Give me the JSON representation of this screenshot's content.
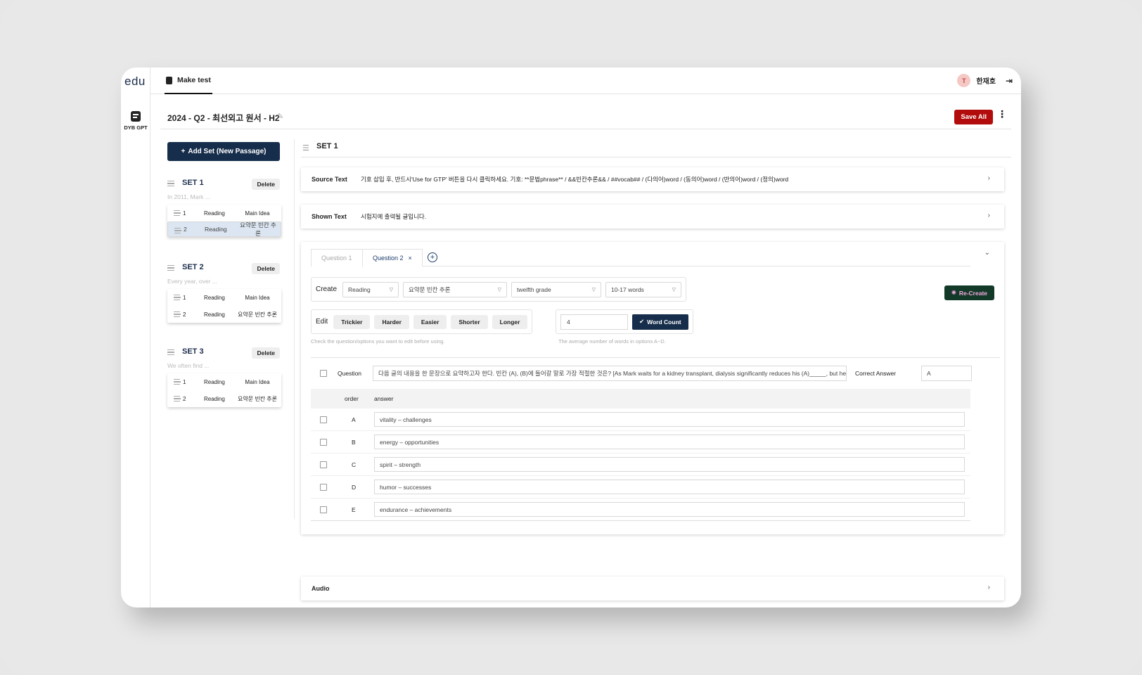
{
  "app": {
    "logo": "edu",
    "rail_item": "DYB GPT"
  },
  "topbar": {
    "tab": "Make test",
    "user_initial": "T",
    "user_name": "한재호"
  },
  "header": {
    "title": "2024 - Q2 - 최선외고 원서 - H2",
    "save_all": "Save All"
  },
  "sidebar": {
    "add_set": "Add Set (New Passage)",
    "delete_label": "Delete",
    "sets": [
      {
        "name": "SET 1",
        "preview": "In 2011, Mark ...",
        "questions": [
          {
            "n": "1",
            "type": "Reading",
            "kind": "Main Idea"
          },
          {
            "n": "2",
            "type": "Reading",
            "kind": "요약문 빈칸 추론"
          }
        ]
      },
      {
        "name": "SET 2",
        "preview": "Every year, over ...",
        "questions": [
          {
            "n": "1",
            "type": "Reading",
            "kind": "Main Idea"
          },
          {
            "n": "2",
            "type": "Reading",
            "kind": "요약문 빈칸 추론"
          }
        ]
      },
      {
        "name": "SET 3",
        "preview": "We often find ...",
        "questions": [
          {
            "n": "1",
            "type": "Reading",
            "kind": "Main Idea"
          },
          {
            "n": "2",
            "type": "Reading",
            "kind": "요약문 빈칸 추론"
          }
        ]
      }
    ]
  },
  "main": {
    "set_title": "SET 1",
    "source_label": "Source Text",
    "source_text": "기호 삽입 후, 반드시'Use for GTP' 버튼을 다시 클릭하세요. 기호: **문법phrase** / &&빈칸추론&& / ##vocab## / (다의어)word / (동의어)word / (반의어)word / (정의)word",
    "shown_label": "Shown Text",
    "shown_text": "시험지에 출력될 글입니다.",
    "tabs": {
      "q1": "Question 1",
      "q2": "Question 2"
    },
    "create": {
      "label": "Create",
      "type": "Reading",
      "kind": "요약문 빈칸 추론",
      "grade": "twelfth grade",
      "length": "10-17 words",
      "recreate": "Re-Create"
    },
    "edit": {
      "label": "Edit",
      "buttons": [
        "Trickier",
        "Harder",
        "Easier",
        "Shorter",
        "Longer"
      ],
      "hint": "Check the question/options you want to edit before using.",
      "word_count_value": "4",
      "word_count_label": "Word Count",
      "word_count_hint": "The average number of words in options A~D."
    },
    "question": {
      "label": "Question",
      "text": "다음 글의 내용을 한 문장으로 요약하고자 한다. 빈칸 (A), (B)에 들어갈 말로 가장 적절한 것은? [As Mark waits for a kidney transplant, dialysis significantly reduces his (A)_____, but he shows remarkable (B)_____ in facing life's difficulties.]",
      "correct_label": "Correct Answer",
      "correct_value": "A"
    },
    "table": {
      "col_order": "order",
      "col_answer": "answer"
    },
    "answers": [
      {
        "letter": "A",
        "text": "vitality – challenges"
      },
      {
        "letter": "B",
        "text": "energy – opportunities"
      },
      {
        "letter": "C",
        "text": "spirit – strength"
      },
      {
        "letter": "D",
        "text": "humor – successes"
      },
      {
        "letter": "E",
        "text": "endurance – achievements"
      }
    ],
    "audio_label": "Audio"
  },
  "colors": {
    "navy": "#162d4b",
    "save_red": "#b20c0c",
    "recreate_bg": "#133a28",
    "recreate_text": "#f2a8e0"
  }
}
